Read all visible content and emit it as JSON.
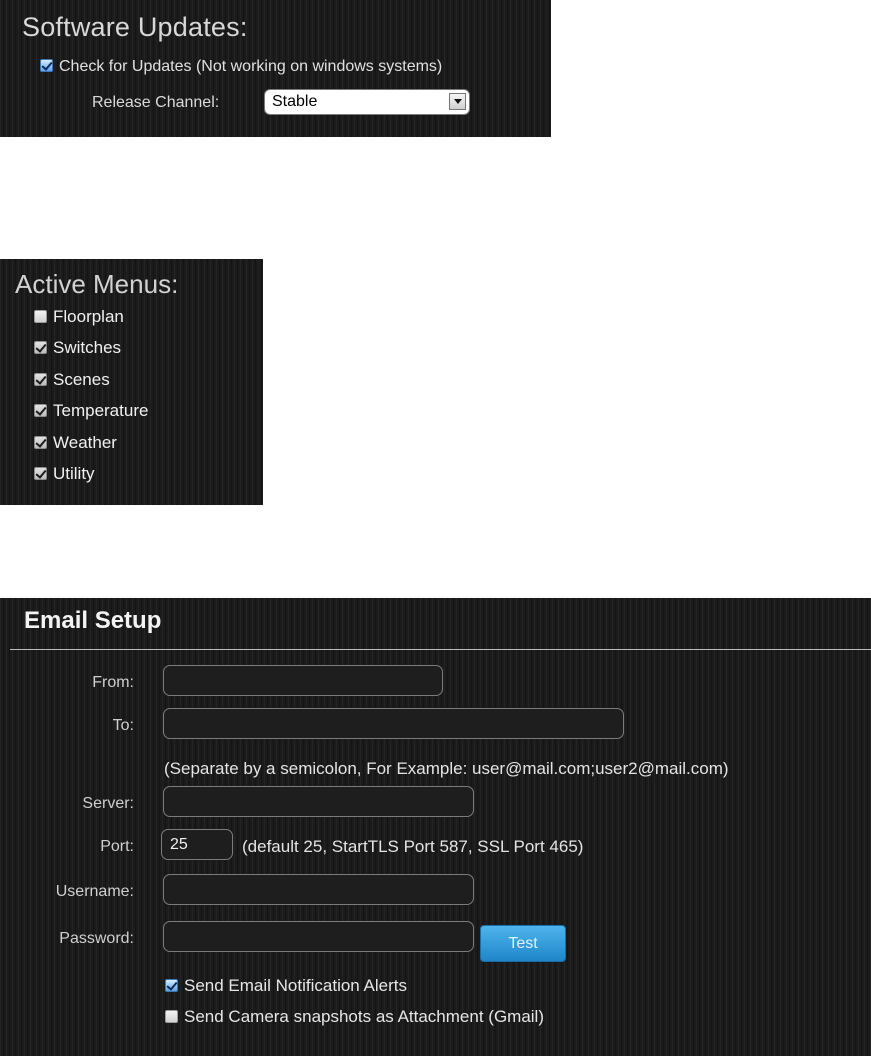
{
  "software_updates": {
    "title": "Software Updates:",
    "check_label": "Check for Updates (Not working on windows systems)",
    "check_checked": true,
    "channel_label": "Release Channel:",
    "channel_value": "Stable"
  },
  "active_menus": {
    "title": "Active Menus:",
    "items": [
      {
        "label": "Floorplan",
        "checked": false
      },
      {
        "label": "Switches",
        "checked": true
      },
      {
        "label": "Scenes",
        "checked": true
      },
      {
        "label": "Temperature",
        "checked": true
      },
      {
        "label": "Weather",
        "checked": true
      },
      {
        "label": "Utility",
        "checked": true
      }
    ]
  },
  "email_setup": {
    "title": "Email Setup",
    "from_label": "From:",
    "from_value": "",
    "to_label": "To:",
    "to_value": "",
    "to_hint": "(Separate by a semicolon, For Example: user@mail.com;user2@mail.com)",
    "server_label": "Server:",
    "server_value": "",
    "port_label": "Port:",
    "port_value": "25",
    "port_hint": "(default 25, StartTLS Port 587, SSL Port 465)",
    "username_label": "Username:",
    "username_value": "",
    "password_label": "Password:",
    "password_value": "",
    "test_button": "Test",
    "notify_label": "Send Email Notification Alerts",
    "notify_checked": true,
    "snapshot_label": "Send Camera snapshots as Attachment (Gmail)",
    "snapshot_checked": false
  },
  "colors": {
    "panel_bg": "#1b1b1b",
    "test_button": "#2f9ad9",
    "checkbox_accent": "#5fa2e6"
  }
}
